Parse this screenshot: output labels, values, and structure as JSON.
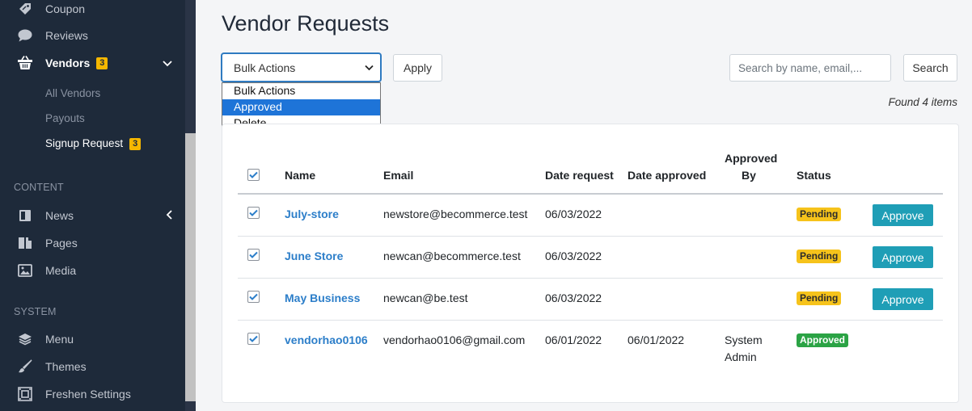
{
  "sidebar": {
    "items_top": [
      {
        "label": "Coupon",
        "icon": "tag-icon"
      },
      {
        "label": "Reviews",
        "icon": "comment-icon"
      }
    ],
    "vendors": {
      "label": "Vendors",
      "badge": "3",
      "icon": "basket-icon"
    },
    "vendor_sub": [
      {
        "label": "All Vendors"
      },
      {
        "label": "Payouts"
      },
      {
        "label": "Signup Request",
        "badge": "3"
      }
    ],
    "content_title": "CONTENT",
    "content_items": [
      {
        "label": "News",
        "icon": "news-icon"
      },
      {
        "label": "Pages",
        "icon": "pages-icon"
      },
      {
        "label": "Media",
        "icon": "image-icon"
      }
    ],
    "system_title": "SYSTEM",
    "system_items": [
      {
        "label": "Menu",
        "icon": "layers-icon"
      },
      {
        "label": "Themes",
        "icon": "brush-icon"
      },
      {
        "label": "Freshen Settings",
        "icon": "settings-frame-icon"
      }
    ]
  },
  "main": {
    "title": "Vendor Requests",
    "bulk_select": {
      "value": "Bulk Actions",
      "options": [
        "Bulk Actions",
        "Approved",
        "Delete"
      ],
      "highlighted": "Approved"
    },
    "apply_label": "Apply",
    "search": {
      "placeholder": "Search by name, email,...",
      "button": "Search"
    },
    "found_text": "Found 4 items",
    "table": {
      "headers": {
        "name": "Name",
        "email": "Email",
        "date_request": "Date request",
        "date_approved": "Date approved",
        "approved_by_1": "Approved",
        "approved_by_2": "By",
        "status": "Status"
      },
      "rows": [
        {
          "name": "July-store",
          "email": "newstore@becommerce.test",
          "date_request": "06/03/2022",
          "date_approved": "",
          "approved_by_1": "",
          "approved_by_2": "",
          "status": "Pending",
          "action": "Approve"
        },
        {
          "name": "June Store",
          "email": "newcan@becommerce.test",
          "date_request": "06/03/2022",
          "date_approved": "",
          "approved_by_1": "",
          "approved_by_2": "",
          "status": "Pending",
          "action": "Approve"
        },
        {
          "name": "May Business",
          "email": "newcan@be.test",
          "date_request": "06/03/2022",
          "date_approved": "",
          "approved_by_1": "",
          "approved_by_2": "",
          "status": "Pending",
          "action": "Approve"
        },
        {
          "name": "vendorhao0106",
          "email": "vendorhao0106@gmail.com",
          "date_request": "06/01/2022",
          "date_approved": "06/01/2022",
          "approved_by_1": "System",
          "approved_by_2": "Admin",
          "status": "Approved",
          "action": ""
        }
      ]
    }
  },
  "colors": {
    "sidebar_bg": "#1e2a3a",
    "accent": "#2c7ec9",
    "approve_button": "#1f9eb6",
    "pending": "#f6c31b",
    "approved": "#2ba345",
    "badge": "#f5b700"
  }
}
